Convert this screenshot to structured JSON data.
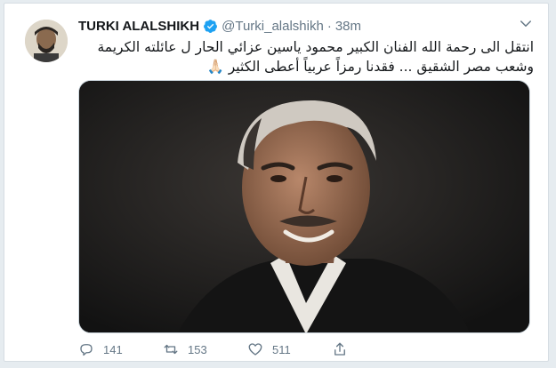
{
  "tweet": {
    "author_name": "TURKI ALALSHIKH",
    "handle": "@Turki_alalshikh",
    "separator": "·",
    "time": "38m",
    "text": "انتقل الى رحمة الله الفنان الكبير محمود ياسين عزائي الحار ل عائلته الكريمة وشعب مصر الشقيق ... فقدنا رمزاً عربياً أعطى الكثير 🙏🏻",
    "counts": {
      "replies": "141",
      "retweets": "153",
      "likes": "511"
    }
  },
  "icons": {
    "verified": "verified-badge-icon",
    "menu": "chevron-down-icon",
    "reply": "reply-icon",
    "retweet": "retweet-icon",
    "like": "heart-icon",
    "share": "share-icon"
  },
  "colors": {
    "verified": "#1da1f2",
    "muted": "#657786",
    "text": "#14171a",
    "background": "#e6ecf0"
  }
}
